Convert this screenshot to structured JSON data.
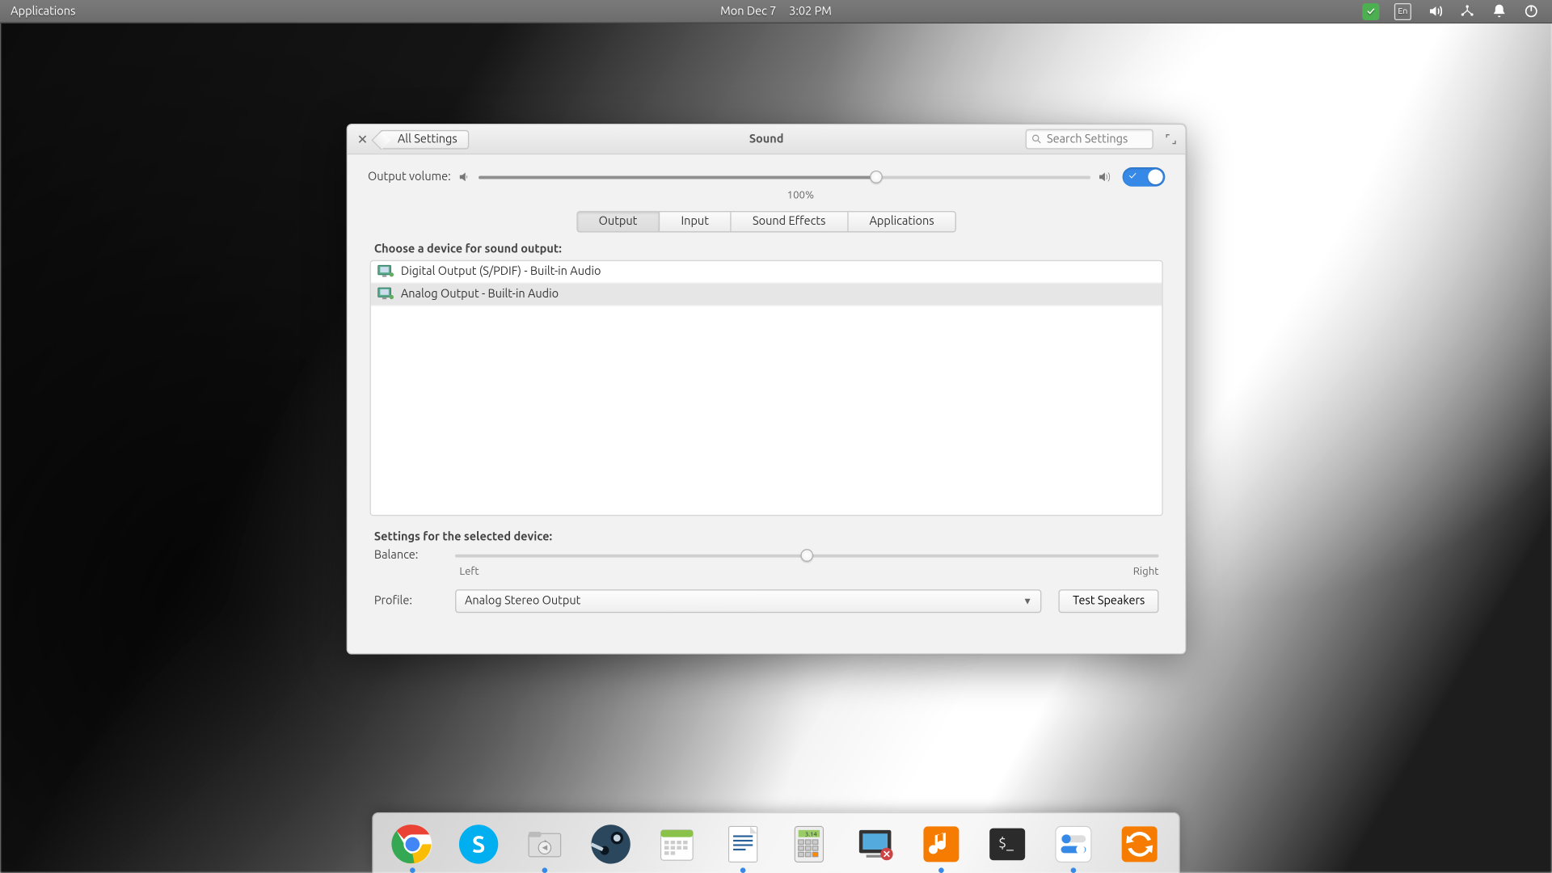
{
  "panel": {
    "applications": "Applications",
    "date": "Mon Dec  7",
    "time": "3:02 PM",
    "lang": "En"
  },
  "window": {
    "back": "All Settings",
    "title": "Sound",
    "search_placeholder": "Search Settings"
  },
  "volume": {
    "label": "Output volume:",
    "percent_label": "100%",
    "percent": 65,
    "enabled": true
  },
  "tabs": {
    "items": [
      "Output",
      "Input",
      "Sound Effects",
      "Applications"
    ],
    "active": 0
  },
  "output": {
    "choose_label": "Choose a device for sound output:",
    "devices": [
      "Digital Output (S/PDIF) - Built-in Audio",
      "Analog Output - Built-in Audio"
    ],
    "selected": 1
  },
  "settings": {
    "heading": "Settings for the selected device:",
    "balance_label": "Balance:",
    "balance_left": "Left",
    "balance_right": "Right",
    "balance_value": 50,
    "profile_label": "Profile:",
    "profile_value": "Analog Stereo Output",
    "test_speakers": "Test Speakers"
  },
  "dock": {
    "items": [
      {
        "name": "chrome",
        "running": true
      },
      {
        "name": "skype",
        "running": false
      },
      {
        "name": "files",
        "running": true
      },
      {
        "name": "steam",
        "running": false
      },
      {
        "name": "calendar",
        "running": false
      },
      {
        "name": "libreoffice-writer",
        "running": true
      },
      {
        "name": "calculator",
        "running": false
      },
      {
        "name": "screenshot",
        "running": false
      },
      {
        "name": "music",
        "running": true
      },
      {
        "name": "terminal",
        "running": false
      },
      {
        "name": "switchboard",
        "running": true
      },
      {
        "name": "update",
        "running": false
      }
    ]
  }
}
